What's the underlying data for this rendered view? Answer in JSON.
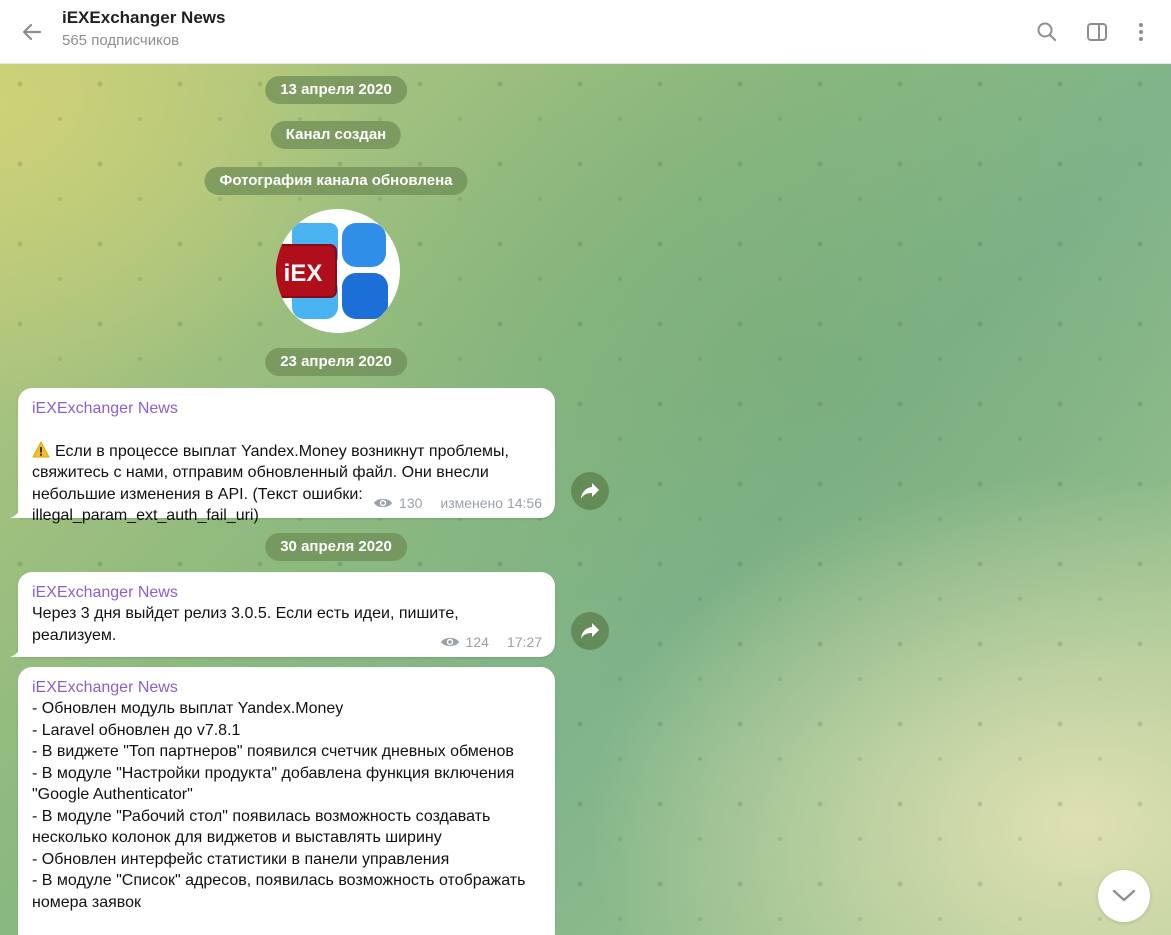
{
  "header": {
    "title": "iEXExchanger News",
    "subtitle": "565 подписчиков"
  },
  "service": {
    "date1": "13 апреля 2020",
    "created": "Канал создан",
    "photo_updated": "Фотография канала обновлена",
    "date2": "23 апреля 2020",
    "date3": "30 апреля 2020"
  },
  "avatar": {
    "logo_text": "iEX",
    "colors": {
      "red": "#b10e1b",
      "blue": "#2f8fe8",
      "light_blue": "#4ab4f2"
    }
  },
  "messages": [
    {
      "author": "iEXExchanger News",
      "icon": "warning-icon",
      "text": "Если в процессе выплат Yandex.Money возникнут проблемы, свяжитесь с нами, отправим обновленный файл. Они внесли небольшие изменения в API. (Текст ошибки: illegal_param_ext_auth_fail_uri)",
      "views": "130",
      "time": "изменено 14:56"
    },
    {
      "author": "iEXExchanger News",
      "text": "Через 3 дня выйдет релиз 3.0.5. Если есть идеи, пишите, реализуем.",
      "views": "124",
      "time": "17:27"
    },
    {
      "author": "iEXExchanger News",
      "text": "- Обновлен модуль выплат Yandex.Money\n- Laravel обновлен до v7.8.1\n- В виджете \"Топ партнеров\" появился счетчик дневных обменов\n- В модуле \"Настройки продукта\" добавлена функция включения \"Google Authenticator\"\n- В модуле \"Рабочий стол\" появилась возможность создавать несколько колонок для виджетов и выставлять ширину\n- Обновлен интерфейс статистики в панели управления\n- В модуле \"Список\" адресов, появилась возможность отображать номера заявок"
    }
  ],
  "theme": {
    "accent_author": "#8a5fcf",
    "service_bg": "#6e8c55"
  }
}
